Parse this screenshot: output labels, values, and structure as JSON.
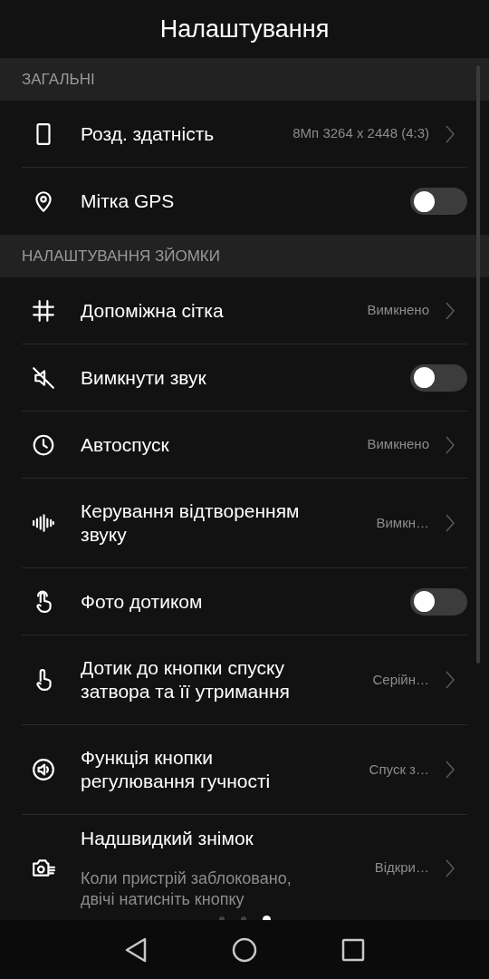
{
  "title": "Налаштування",
  "sections": [
    {
      "header": "ЗАГАЛЬНІ",
      "items": [
        {
          "kind": "value",
          "label": "Розд. здатність",
          "value": "8Мп 3264 x 2448 (4:3)"
        },
        {
          "kind": "toggle",
          "label": "Мітка GPS",
          "on": false
        }
      ]
    },
    {
      "header": "НАЛАШТУВАННЯ ЗЙОМКИ",
      "items": [
        {
          "kind": "value",
          "label": "Допоміжна сітка",
          "value": "Вимкнено"
        },
        {
          "kind": "toggle",
          "label": "Вимкнути звук",
          "on": false
        },
        {
          "kind": "value",
          "label": "Автоспуск",
          "value": "Вимкнено"
        },
        {
          "kind": "value",
          "label": "Керування відтворенням звуку",
          "value": "Вимкн…"
        },
        {
          "kind": "toggle",
          "label": "Фото дотиком",
          "on": false
        },
        {
          "kind": "value",
          "label": "Дотик до кнопки спуску затвора та її утримання",
          "value": "Серійн…"
        },
        {
          "kind": "value",
          "label": "Функція кнопки регулювання гучності",
          "value": "Спуск з…"
        },
        {
          "kind": "value",
          "label": "Надшвидкий знімок",
          "subtitle": "Коли пристрій заблоковано, двічі натисніть кнопку",
          "value": "Відкри…"
        }
      ]
    }
  ],
  "page_dots": [
    {
      "selected": false
    },
    {
      "selected": false
    },
    {
      "selected": true
    }
  ]
}
